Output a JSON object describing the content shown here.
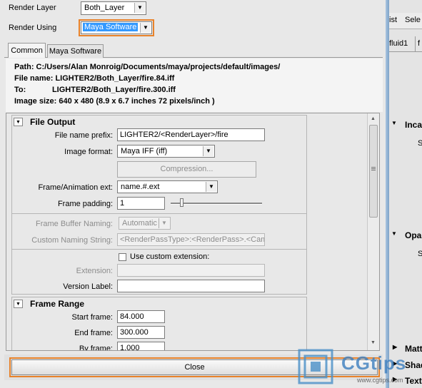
{
  "render_layer": {
    "label": "Render Layer",
    "value": "Both_Layer"
  },
  "render_using": {
    "label": "Render Using",
    "value": "Maya Software"
  },
  "tabs": [
    {
      "label": "Common"
    },
    {
      "label": "Maya Software"
    }
  ],
  "info": {
    "path": "Path:  C:/Users/Alan Monroig/Documents/maya/projects/default/images/",
    "file_name": "File name:  LIGHTER2/Both_Layer/fire.84.iff",
    "to": "To:            LIGHTER2/Both_Layer/fire.300.iff",
    "image_size": "Image size:  640 x 480 (8.9 x 6.7 inches 72 pixels/inch )"
  },
  "file_output": {
    "title": "File Output",
    "prefix_label": "File name prefix:",
    "prefix_value": "LIGHTER2/<RenderLayer>/fire",
    "format_label": "Image format:",
    "format_value": "Maya IFF (iff)",
    "compression_label": "Compression...",
    "ext_label": "Frame/Animation ext:",
    "ext_value": "name.#.ext",
    "padding_label": "Frame padding:",
    "padding_value": "1",
    "fb_label": "Frame Buffer Naming:",
    "fb_value": "Automatic",
    "custom_naming_label": "Custom Naming String:",
    "custom_naming_value": "<RenderPassType>:<RenderPass>.<Came",
    "use_custom_ext_label": "Use custom extension:",
    "extension_label": "Extension:",
    "version_label": "Version Label:"
  },
  "frame_range": {
    "title": "Frame Range",
    "start_label": "Start frame:",
    "start_value": "84.000",
    "end_label": "End frame:",
    "end_value": "300.000",
    "by_label": "By frame:",
    "by_value": "1.000"
  },
  "close_label": "Close",
  "background_app": {
    "list_label": "ist",
    "select_label": "Sele",
    "fluid_tab": "fluid1",
    "tab_f": "f",
    "incandescence": "Inca",
    "s1": "S",
    "opacity": "Opa",
    "s2": "S",
    "matte": "Matt",
    "shading": "Shad",
    "texture": "Text"
  },
  "watermark": {
    "brand": "CGtips",
    "url": "www.cgtips.com"
  },
  "colors": {
    "highlight_orange": "#e8822a",
    "selection_blue": "#3399ff"
  }
}
